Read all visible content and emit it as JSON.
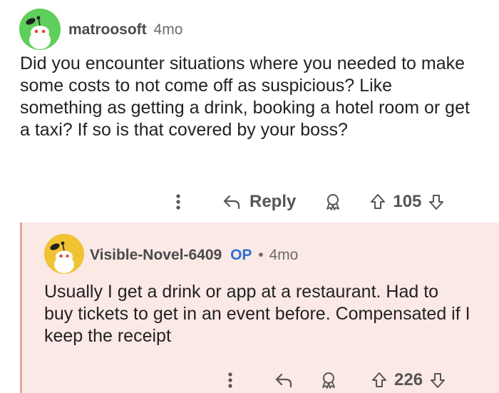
{
  "comment": {
    "username": "matroosoft",
    "age": "4mo",
    "body": "Did you encounter situations where you needed to make some costs to not come off as suspicious? Like something as getting a drink, booking a hotel room or get a taxi? If so is that covered by your boss?",
    "actions": {
      "reply_label": "Reply",
      "score": "105"
    },
    "colors": {
      "avatar_bg": "#5fcf5b"
    }
  },
  "reply": {
    "username": "Visible-Novel-6409",
    "op_badge": "OP",
    "separator": "•",
    "age": "4mo",
    "body": "Usually I get a drink or app at a restaurant. Had to buy tickets to get in an event before. Compensated if I keep the receipt",
    "actions": {
      "score": "226"
    },
    "colors": {
      "avatar_bg": "#f1c232",
      "thread_bg": "#fbe9e6",
      "thread_line": "#e3a59b",
      "op_color": "#2f6fd6"
    }
  },
  "icons": [
    "snoo-avatar-icon",
    "more-options-icon",
    "reply-arrow-icon",
    "award-icon",
    "upvote-icon",
    "downvote-icon"
  ]
}
